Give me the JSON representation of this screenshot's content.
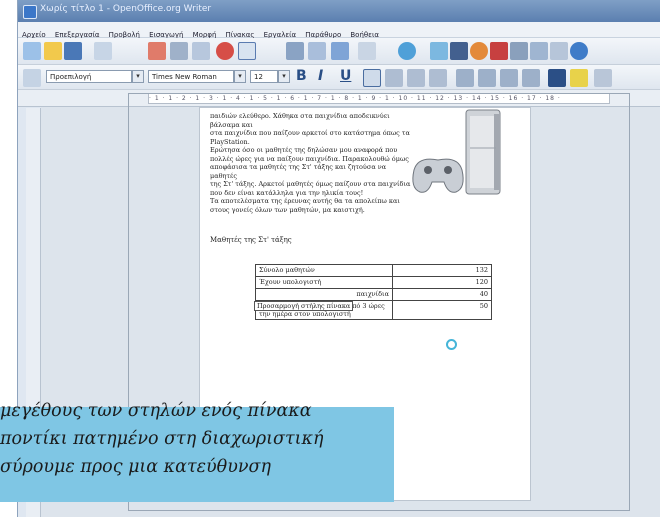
{
  "window": {
    "title": "Χωρίς τίτλο 1 - OpenOffice.org Writer"
  },
  "menu": [
    "Αρχείο",
    "Επεξεργασία",
    "Προβολή",
    "Εισαγωγή",
    "Μορφή",
    "Πίνακας",
    "Εργαλεία",
    "Παράθυρο",
    "Βοήθεια"
  ],
  "format_bar": {
    "style": "Προεπιλογή",
    "font": "Times New Roman",
    "size": "12",
    "bold": "B",
    "italic": "I",
    "underline": "U"
  },
  "ruler": {
    "scale": "· 1 · 1 · 2 · 1 · 3 · 1 · 4 · 1 · 5 · 1 · 6 · 1 · 7 · 1 · 8 · 1 · 9 · 1 · 10 · 11 · 12 · 13 · 14 · 15 · 16 · 17 · 18 ·"
  },
  "document": {
    "paragraphs": [
      "παιδιών ελεύθερο. Χάθηκα στα παιχνίδια αποδεικνύει βάλσαμα και",
      "στα παιχνίδια που παίζουν αρκετοί στο κατάστημα όπως τα",
      "PlayStation.",
      "Ερώτησα όσο οι μαθητές της δηλώσαν μου αναφορά που",
      "πολλές ώρες για να παίξουν παιχνίδια. Παρακολουθώ όμως",
      "αποφάσισα τα μαθητές της Στ' τάξης και ζητούσα να μαθητές",
      "της Στ' τάξης. Αρκετοί μαθητές όμως παίζουν στα παιχνίδια",
      "που δεν είναι κατάλληλα για την ηλικία τους!",
      "Τα αποτελέσματα της έρευνας αυτής θα τα απολείπω και",
      "στους γονείς όλων των μαθητών, μα καιστιχή."
    ],
    "signature": "Μαθητές της Στ' τάξης",
    "table": [
      {
        "label": "Σύνολο μαθητών",
        "value": "132"
      },
      {
        "label": "Έχουν υπολογιστή",
        "value": "120"
      },
      {
        "label": "παιχνίδια",
        "value": "40"
      },
      {
        "label": "Αφιερώνουν περισσότερες από 3 ώρες την ημέρα στον υπολογιστή",
        "value": "50"
      }
    ],
    "tooltip": "Προσαρμογή στήλης πίνακα"
  },
  "callout": {
    "lines": [
      "μεγέθους των στηλών ενός πίνακα",
      "ποντίκι πατημένο στη διαχωριστική",
      "σύρουμε προς μια κατεύθυνση"
    ],
    "color": "#7fc6e4"
  }
}
